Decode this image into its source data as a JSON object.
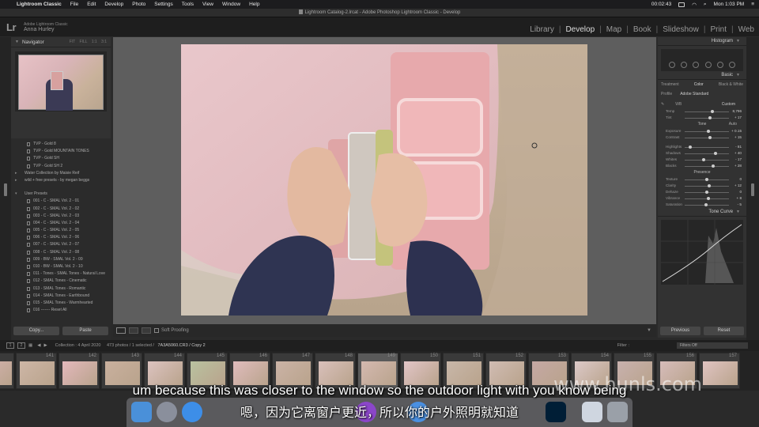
{
  "menubar": {
    "app": "Lightroom Classic",
    "items": [
      "File",
      "Edit",
      "Develop",
      "Photo",
      "Settings",
      "Tools",
      "View",
      "Window",
      "Help"
    ],
    "timer": "00:02:43",
    "clock": "Mon 1:03 PM"
  },
  "window_title": "Lightroom Catalog-2.lrcat - Adobe Photoshop Lightroom Classic - Develop",
  "identity": {
    "small": "Adobe Lightroom Classic",
    "name": "Anna Hurley",
    "logo": "Lr"
  },
  "modules": [
    "Library",
    "Develop",
    "Map",
    "Book",
    "Slideshow",
    "Print",
    "Web"
  ],
  "active_module": "Develop",
  "left_panel": {
    "navigator_title": "Navigator",
    "navigator_opts": "FIT FILL 1:1 3:1",
    "presets": [
      {
        "type": "item",
        "label": "TVP - Gold 8"
      },
      {
        "type": "item",
        "label": "TVP - Gold MOUNTAIN TONES"
      },
      {
        "type": "item",
        "label": "TVP - Gold SH"
      },
      {
        "type": "item",
        "label": "TVP - Gold SH 2"
      },
      {
        "type": "folder",
        "label": "Water Collection by Maisie Reif"
      },
      {
        "type": "folder",
        "label": "wild + free presets - by megan beggs"
      },
      {
        "type": "gap"
      },
      {
        "type": "folder-open",
        "label": "User Presets"
      },
      {
        "type": "item",
        "label": "001 - C - SMAL Vol. 2 - 01"
      },
      {
        "type": "item",
        "label": "002 - C - SMAL Vol. 2 - 02"
      },
      {
        "type": "item",
        "label": "003 - C - SMAL Vol. 2 - 03"
      },
      {
        "type": "item",
        "label": "004 - C - SMAL Vol. 2 - 04"
      },
      {
        "type": "item",
        "label": "005 - C - SMAL Vol. 2 - 05"
      },
      {
        "type": "item",
        "label": "006 - C - SMAL Vol. 2 - 06"
      },
      {
        "type": "item",
        "label": "007 - C - SMAL Vol. 2 - 07"
      },
      {
        "type": "item",
        "label": "008 - C - SMAL Vol. 2 - 08"
      },
      {
        "type": "item",
        "label": "009 - BW - SMAL Vol. 2 - 09"
      },
      {
        "type": "item",
        "label": "010 - BW - SMAL Vol. 2 - 10"
      },
      {
        "type": "item",
        "label": "011 - Tones - SMAL Tones - Natural Love"
      },
      {
        "type": "item",
        "label": "012 - SMAL Tones - Cinematic"
      },
      {
        "type": "item",
        "label": "013 - SMAL Tones - Romantic"
      },
      {
        "type": "item",
        "label": "014 - SMAL Tones - Earthbound"
      },
      {
        "type": "item",
        "label": "015 - SMAL Tones - Warmhearted"
      },
      {
        "type": "item",
        "label": "016 ------- Reset All"
      }
    ],
    "copy_label": "Copy...",
    "paste_label": "Paste"
  },
  "toolbar": {
    "soft_proofing": "Soft Proofing"
  },
  "right_panel": {
    "histogram_title": "Histogram",
    "basic_title": "Basic",
    "treatment": [
      "Treatment",
      "Color",
      "Black & White"
    ],
    "profile_label": "Profile",
    "profile_value": "Adobe Standard",
    "wb_label": "WB",
    "wb_value": "Custom",
    "wb_sliders": [
      {
        "label": "Temp",
        "value": "8,796",
        "pos": 0.62
      },
      {
        "label": "Tint",
        "value": "+ 17",
        "pos": 0.58
      }
    ],
    "tone_label": "Tone",
    "auto_label": "Auto",
    "tone_sliders": [
      {
        "label": "Exposure",
        "value": "+ 0.15",
        "pos": 0.53
      },
      {
        "label": "Contrast",
        "value": "+ 15",
        "pos": 0.58
      }
    ],
    "light_sliders": [
      {
        "label": "Highlights",
        "value": "- 81",
        "pos": 0.12
      },
      {
        "label": "Shadows",
        "value": "+ 40",
        "pos": 0.7
      },
      {
        "label": "Whites",
        "value": "- 17",
        "pos": 0.42
      },
      {
        "label": "Blacks",
        "value": "+ 28",
        "pos": 0.64
      }
    ],
    "presence_label": "Presence",
    "presence_sliders": [
      {
        "label": "Texture",
        "value": "0",
        "pos": 0.5
      },
      {
        "label": "Clarity",
        "value": "+ 12",
        "pos": 0.56
      },
      {
        "label": "Dehaze",
        "value": "0",
        "pos": 0.5
      },
      {
        "label": "Vibrance",
        "value": "+ 8",
        "pos": 0.54
      },
      {
        "label": "Saturation",
        "value": "- 5",
        "pos": 0.48
      }
    ],
    "tone_curve_title": "Tone Curve",
    "previous_label": "Previous",
    "reset_label": "Reset"
  },
  "filmstrip_bar": {
    "page1": "1",
    "page2": "2",
    "collection": "Collection : 4 April 2020",
    "count": "473 photos / 1 selected /",
    "filename": "7A3A5060.CR3 / Copy 2",
    "filter_label": "Filter :",
    "filter_value": "Filters Off"
  },
  "filmstrip": {
    "numbers": [
      "141",
      "142",
      "143",
      "144",
      "145",
      "146",
      "147",
      "148",
      "149",
      "150",
      "151",
      "152",
      "153",
      "154",
      "155",
      "156",
      "157"
    ],
    "selected_index": 8
  },
  "subtitle_en": "um because this was closer to the window so the outdoor light with you know being",
  "subtitle_zh": "嗯，因为它离窗户更近，所以你的户外照明就知道",
  "watermark": "www.hunls.com",
  "colors": {
    "accent": "#dddddd",
    "panel": "#323232",
    "center": "#5e5e5e"
  }
}
